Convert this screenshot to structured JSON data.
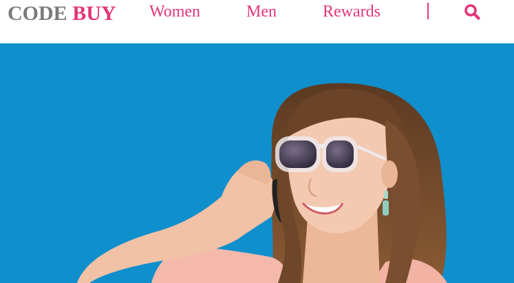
{
  "brand": {
    "word1": "CODE",
    "word2": "BUY",
    "colors": {
      "grey": "#7b7b7b",
      "pink": "#e3357a"
    }
  },
  "nav": {
    "items": [
      {
        "label": "Women"
      },
      {
        "label": "Men"
      },
      {
        "label": "Rewards"
      }
    ],
    "search_icon": "search-icon"
  },
  "hero": {
    "background": "#108fcd",
    "image_subject": "woman-with-sunglasses-on-phone"
  }
}
